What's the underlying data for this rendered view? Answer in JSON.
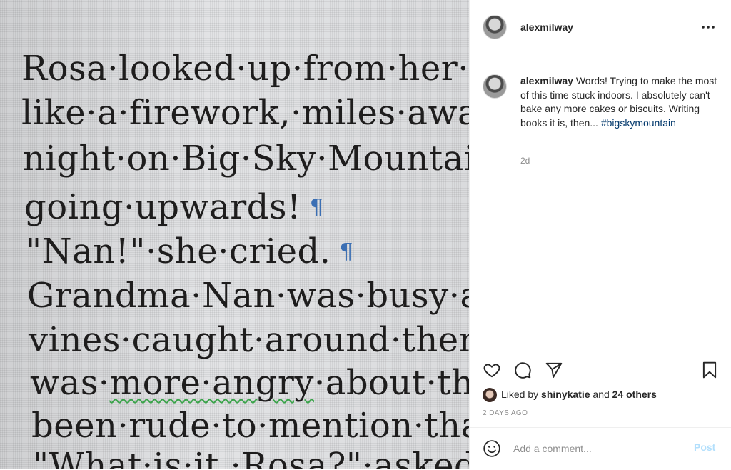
{
  "photo": {
    "lines": [
      "Rosa·looked·up·from·her·w",
      "like·a·firework,·miles·away",
      "night·on·Big·Sky·Mountain,",
      "going·upwards!",
      "\"Nan!\"·she·cried.",
      "Grandma·Nan·was·busy·atte",
      "vines·caught·around·them,·a",
      "was·",
      "more·angry",
      "·about·the·fa",
      "been·rude·to·mention·that.)",
      "\"What·is·it,·Rosa?\"·asked·Na"
    ],
    "pilcrow": "¶"
  },
  "post": {
    "username": "alexmilway",
    "more_icon": "more-horizontal-icon",
    "caption": {
      "author": "alexmilway",
      "text": " Words! Trying to make the most of this time stuck indoors. I absolutely can't bake any more cakes or biscuits. Writing books it is, then... ",
      "hashtag": "#bigskymountain",
      "age": "2d"
    },
    "actions": {
      "icons": [
        "heart-icon",
        "comment-icon",
        "share-icon",
        "bookmark-icon"
      ]
    },
    "likes": {
      "prefix": "Liked by ",
      "liker": "shinykatie",
      "middle": " and ",
      "others": "24 others"
    },
    "date": "2 DAYS AGO",
    "add_comment": {
      "placeholder": "Add a comment...",
      "post_label": "Post"
    }
  }
}
